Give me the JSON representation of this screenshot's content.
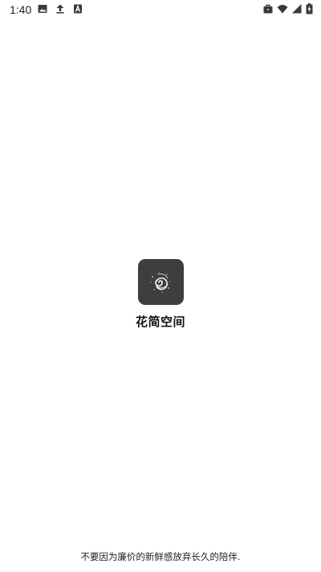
{
  "status_bar": {
    "time": "1:40",
    "left_icons": [
      "image-icon",
      "upload-icon",
      "font-icon"
    ],
    "right_icons": [
      "briefcase-icon",
      "wifi-icon",
      "signal-icon",
      "battery-charging-icon"
    ]
  },
  "app": {
    "name": "花简空间",
    "icon": "galaxy-spiral-icon",
    "icon_bg_color": "#3d3f3f"
  },
  "slogan": "不要因为廉价的新鲜感放弃长久的陪伴."
}
